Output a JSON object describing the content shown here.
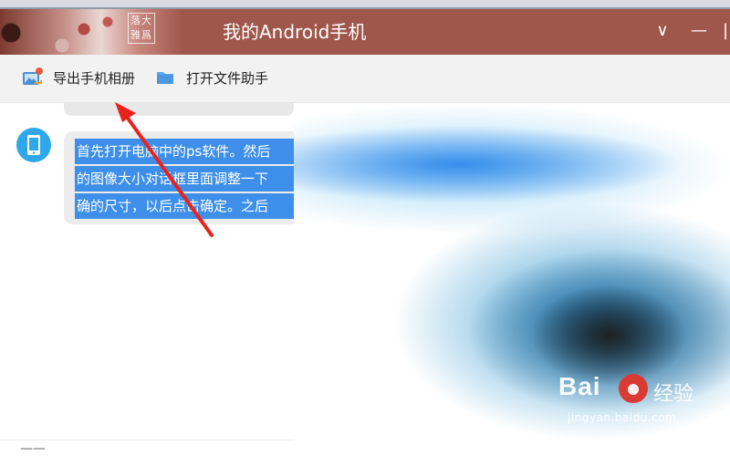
{
  "window": {
    "title": "我的Android手机",
    "seal_text_top": "落大",
    "seal_text_bottom": "雅爲",
    "min_glyph": "∨",
    "minimize_glyph": "—",
    "more_glyph": "|"
  },
  "toolbar": {
    "export_label": "导出手机相册",
    "open_label": "打开文件助手",
    "export_icon": "photo-album-icon",
    "open_icon": "folder-icon"
  },
  "chat": {
    "message_lines": [
      "首先打开电脑中的ps软件。然后",
      "的图像大小对话框里面调整一下",
      "确的尺寸，以后点击确定。之后"
    ],
    "bottom_hint": "——"
  },
  "watermark": {
    "brand": "Bai",
    "brand_suffix": "经验",
    "sub": "jingyan.baidu.com"
  },
  "colors": {
    "titlebar": "#a0574b",
    "toolbar": "#f2f2f2",
    "selection": "#3e8fe9",
    "avatar": "#2ea8e8",
    "annotation": "#e8231d"
  }
}
